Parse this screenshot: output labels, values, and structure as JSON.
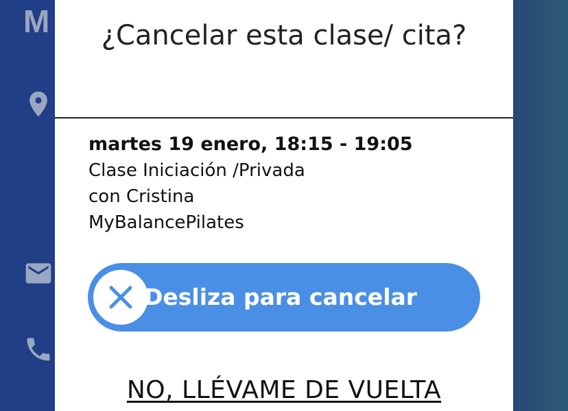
{
  "background": {
    "letter": "M",
    "icons": [
      "location-pin-icon",
      "mail-icon",
      "phone-icon"
    ]
  },
  "modal": {
    "title": "¿Cancelar esta clase/ cita?",
    "details": {
      "datetime": "martes 19 enero, 18:15 - 19:05",
      "class_name": "Clase Iniciación /Privada",
      "instructor": "con Cristina",
      "studio": "MyBalancePilates"
    },
    "slider": {
      "label": "Desliza para cancelar",
      "knob_icon": "close-icon"
    },
    "back_link": "NO, LLÉVAME DE VUELTA"
  },
  "colors": {
    "background_blue": "#213f86",
    "slider_blue": "#4a8fe6",
    "modal_white": "#ffffff"
  }
}
